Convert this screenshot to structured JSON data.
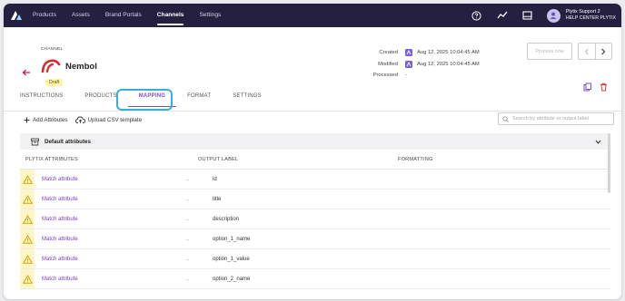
{
  "nav": {
    "items": [
      "Products",
      "Assets",
      "Brand Portals",
      "Channels",
      "Settings"
    ],
    "active_index": 3
  },
  "user": {
    "name": "Plytix Support 2",
    "org": "HELP CENTER PLYTIX"
  },
  "channel": {
    "section_label": "CHANNEL",
    "name": "Nembol",
    "status": "Draft"
  },
  "meta": {
    "created_label": "Created",
    "created_value": "Aug 12, 2025 10:04:45 AM",
    "modified_label": "Modified",
    "modified_value": "Aug 12, 2025 10:04:45 AM",
    "processed_label": "Processed",
    "processed_value": "-"
  },
  "actions": {
    "process_now": "Process now"
  },
  "tabs": [
    "INSTRUCTIONS",
    "PRODUCTS",
    "MAPPING",
    "FORMAT",
    "SETTINGS"
  ],
  "active_tab": "MAPPING",
  "toolbar": {
    "add_attributes": "Add Attributes",
    "upload_csv": "Upload CSV template",
    "search_placeholder": "Search by attribute or output label"
  },
  "panel": {
    "title": "Default attributes",
    "columns": [
      "PLYTIX ATTRIBUTES",
      "OUTPUT LABEL",
      "FORMATTING"
    ],
    "rows": [
      {
        "match": "Match attribute",
        "output": "id"
      },
      {
        "match": "Match attribute",
        "output": "title"
      },
      {
        "match": "Match attribute",
        "output": "description"
      },
      {
        "match": "Match attribute",
        "output": "option_1_name"
      },
      {
        "match": "Match attribute",
        "output": "option_1_value"
      },
      {
        "match": "Match attribute",
        "output": "option_2_name"
      }
    ]
  },
  "colors": {
    "topbar": "#25203f",
    "accent": "#7a4fc5",
    "highlight": "#37b0d7",
    "warning_bg": "#fff6c8",
    "danger": "#d63a3a"
  }
}
